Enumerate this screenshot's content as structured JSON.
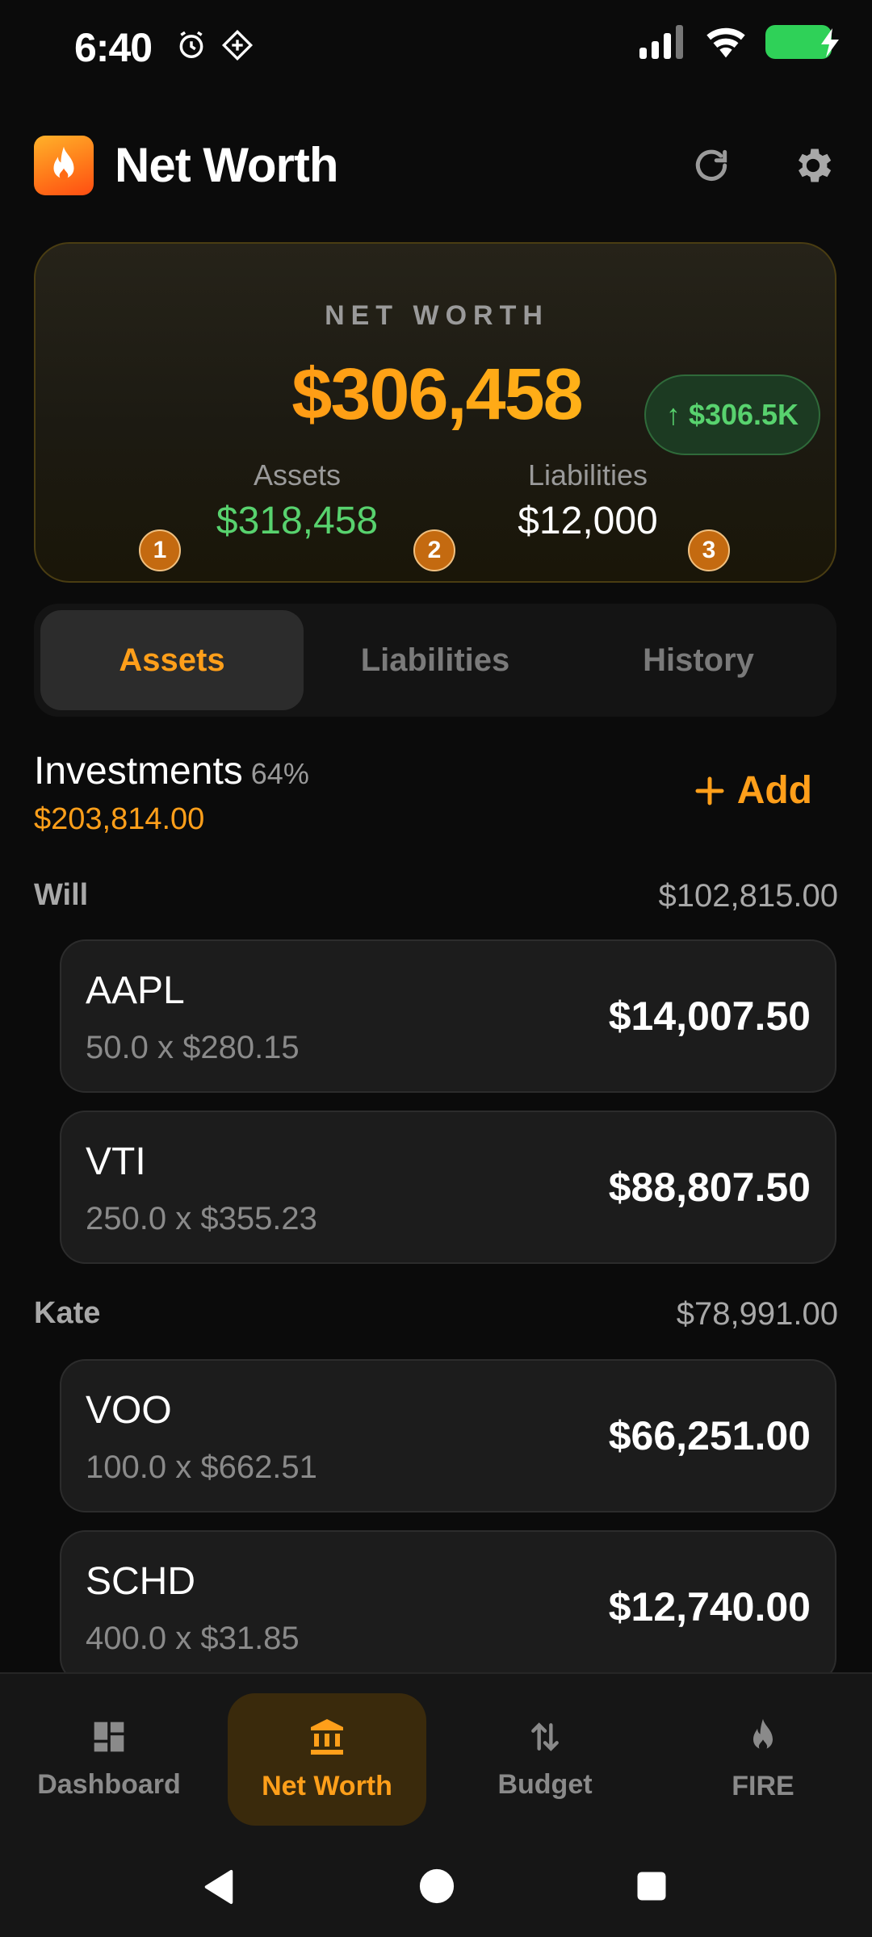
{
  "status_bar": {
    "time": "6:40",
    "left_icons": [
      "alarm-icon",
      "app-icon"
    ],
    "right_icons": [
      "signal-icon",
      "wifi-icon",
      "battery-charging-icon"
    ],
    "battery_color": "#2fd158"
  },
  "header": {
    "title": "Net Worth",
    "refresh_icon": "refresh-icon",
    "settings_icon": "gear-icon"
  },
  "summary": {
    "label": "NET WORTH",
    "total": "$306,458",
    "change": "↑ $306.5K",
    "assets_label": "Assets",
    "assets_value": "$318,458",
    "liabilities_label": "Liabilities",
    "liabilities_value": "$12,000",
    "badges": [
      "1",
      "2",
      "3"
    ],
    "assets_color": "#58d26e",
    "accent_color": "#ff9f1a"
  },
  "tabs": [
    {
      "label": "Assets",
      "active": true
    },
    {
      "label": "Liabilities",
      "active": false
    },
    {
      "label": "History",
      "active": false
    }
  ],
  "section": {
    "title": "Investments",
    "percent": "64%",
    "total": "$203,814.00",
    "add_label": "Add"
  },
  "owners": [
    {
      "name": "Will",
      "total": "$102,815.00",
      "holdings": [
        {
          "ticker": "AAPL",
          "detail": "50.0 x $280.15",
          "value": "$14,007.50"
        },
        {
          "ticker": "VTI",
          "detail": "250.0 x $355.23",
          "value": "$88,807.50"
        }
      ]
    },
    {
      "name": "Kate",
      "total": "$78,991.00",
      "holdings": [
        {
          "ticker": "VOO",
          "detail": "100.0 x $662.51",
          "value": "$66,251.00"
        },
        {
          "ticker": "SCHD",
          "detail": "400.0 x $31.85",
          "value": "$12,740.00"
        }
      ]
    }
  ],
  "bottom_nav": [
    {
      "label": "Dashboard",
      "icon": "dashboard-icon",
      "active": false
    },
    {
      "label": "Net Worth",
      "icon": "bank-icon",
      "active": true
    },
    {
      "label": "Budget",
      "icon": "transfer-icon",
      "active": false
    },
    {
      "label": "FIRE",
      "icon": "flame-icon",
      "active": false
    }
  ]
}
